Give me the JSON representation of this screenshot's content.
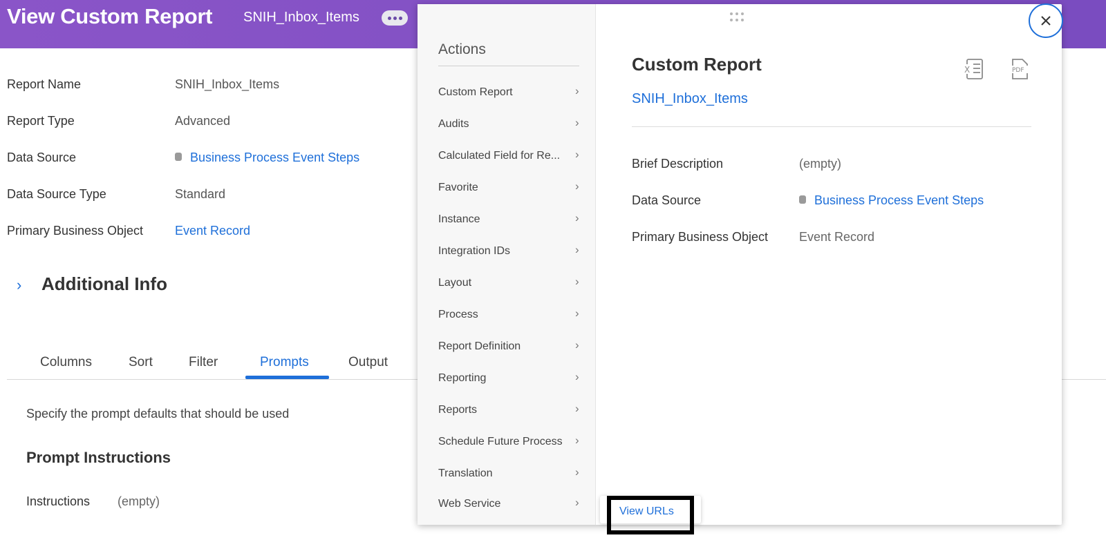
{
  "header": {
    "title": "View Custom Report",
    "subtitle": "SNIH_Inbox_Items",
    "more_icon": "ellipsis-icon"
  },
  "details": [
    {
      "label": "Report Name",
      "value": "SNIH_Inbox_Items"
    },
    {
      "label": "Report Type",
      "value": "Advanced"
    },
    {
      "label": "Data Source",
      "value": "Business Process Event Steps"
    },
    {
      "label": "Data Source Type",
      "value": "Standard"
    },
    {
      "label": "Primary Business Object",
      "value": "Event Record"
    }
  ],
  "additional_info": {
    "title": "Additional Info"
  },
  "tabs": [
    {
      "label": "Columns"
    },
    {
      "label": "Sort"
    },
    {
      "label": "Filter"
    },
    {
      "label": "Prompts"
    },
    {
      "label": "Output"
    }
  ],
  "active_tab": "Prompts",
  "prompts": {
    "description": "Specify the prompt defaults that should be used",
    "heading": "Prompt Instructions",
    "instructions_label": "Instructions",
    "instructions_value": "(empty)"
  },
  "popup": {
    "actions_title": "Actions",
    "actions": [
      {
        "label": "Custom Report"
      },
      {
        "label": "Audits"
      },
      {
        "label": "Calculated Field for Re..."
      },
      {
        "label": "Favorite"
      },
      {
        "label": "Instance"
      },
      {
        "label": "Integration IDs"
      },
      {
        "label": "Layout"
      },
      {
        "label": "Process"
      },
      {
        "label": "Report Definition"
      },
      {
        "label": "Reporting"
      },
      {
        "label": "Reports"
      },
      {
        "label": "Schedule Future Process"
      },
      {
        "label": "Translation"
      },
      {
        "label": "Web Service"
      }
    ],
    "detail_title": "Custom Report",
    "detail_link": "SNIH_Inbox_Items",
    "excel_icon_text": "X",
    "pdf_icon_text": "PDF",
    "detail_rows": [
      {
        "label": "Brief Description",
        "value": "(empty)"
      },
      {
        "label": "Data Source",
        "value": "Business Process Event Steps"
      },
      {
        "label": "Primary Business Object",
        "value": "Event Record"
      }
    ],
    "submenu_item": "View URLs"
  },
  "colors": {
    "header": "#7a4cc0",
    "link": "#1e6fd9",
    "highlight": "#000000"
  }
}
